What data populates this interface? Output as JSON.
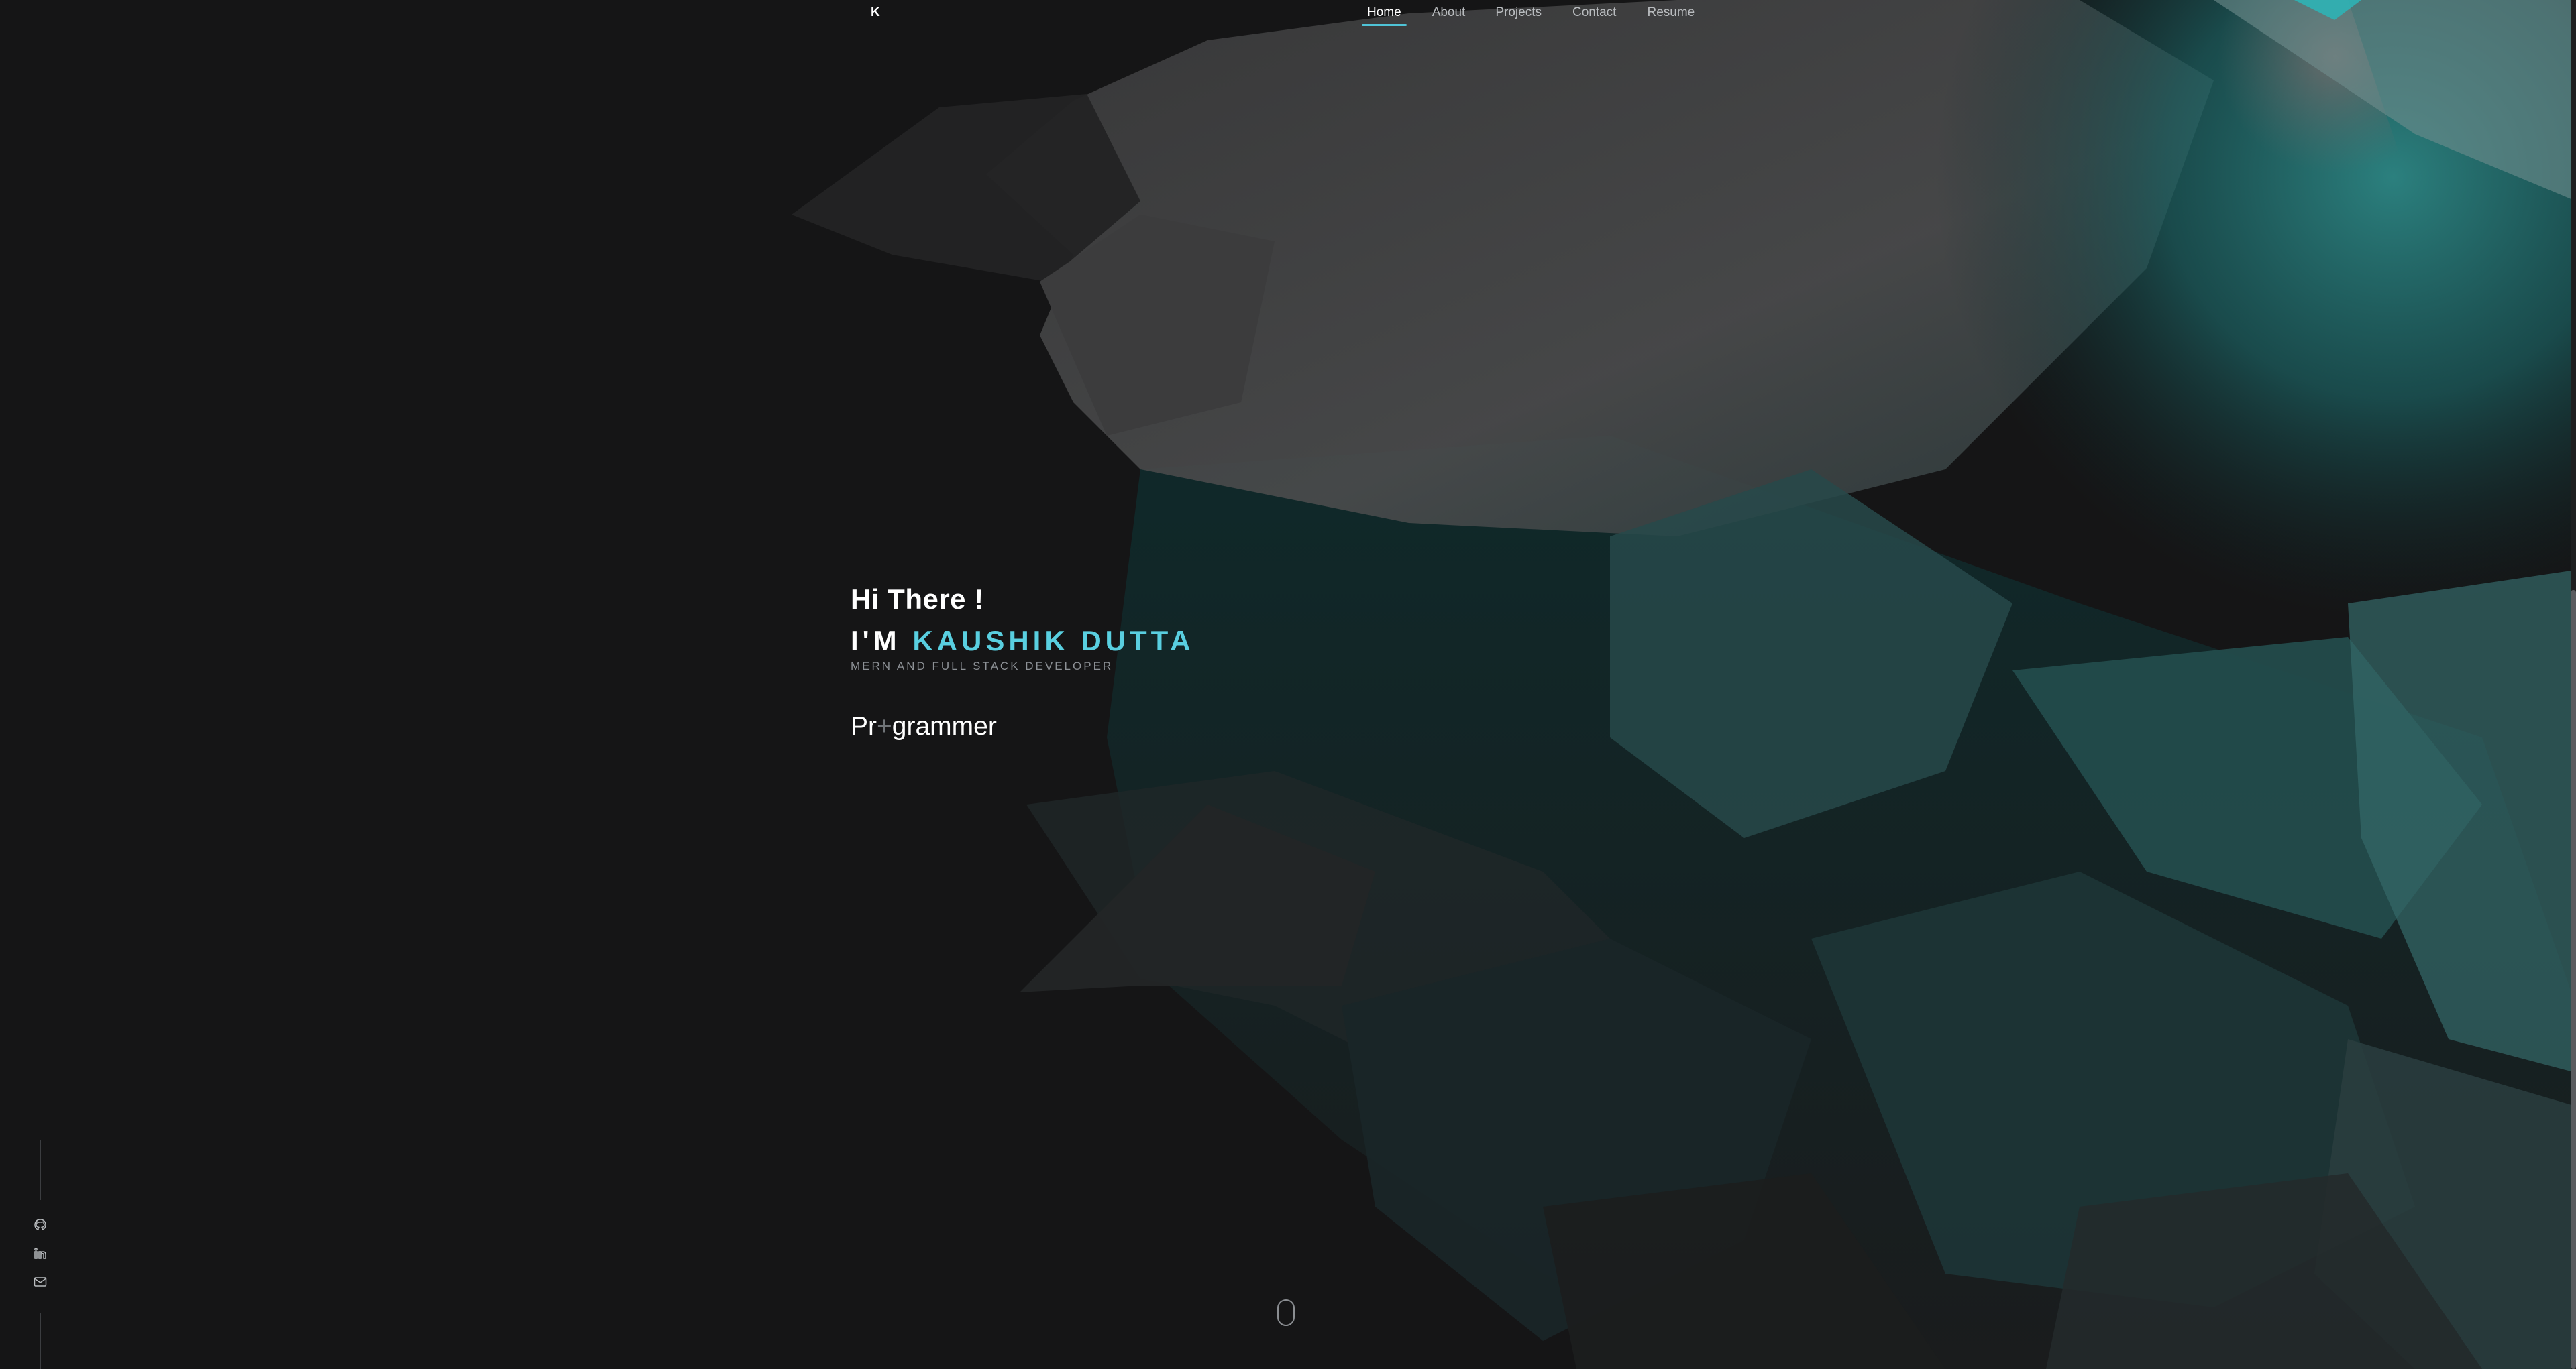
{
  "nav": {
    "logo": "K",
    "links": [
      {
        "label": "Home"
      },
      {
        "label": "About"
      },
      {
        "label": "Projects"
      },
      {
        "label": "Contact"
      },
      {
        "label": "Resume"
      }
    ],
    "active": "Home",
    "accent": "#4fc3d6"
  },
  "hero": {
    "greeting": "Hi There !",
    "intro_prefix": "I'M",
    "name": "KAUSHIK DUTTA",
    "role": "MERN AND FULL STACK DEVELOPER",
    "typed_before": "Pr",
    "typed_cursor": "+",
    "typed_after": "grammer",
    "name_color": "#59cfe0"
  },
  "social": {
    "icons": [
      "github-icon",
      "linkedin-icon",
      "mail-icon"
    ]
  },
  "scroll_indicator": "mouse-icon"
}
